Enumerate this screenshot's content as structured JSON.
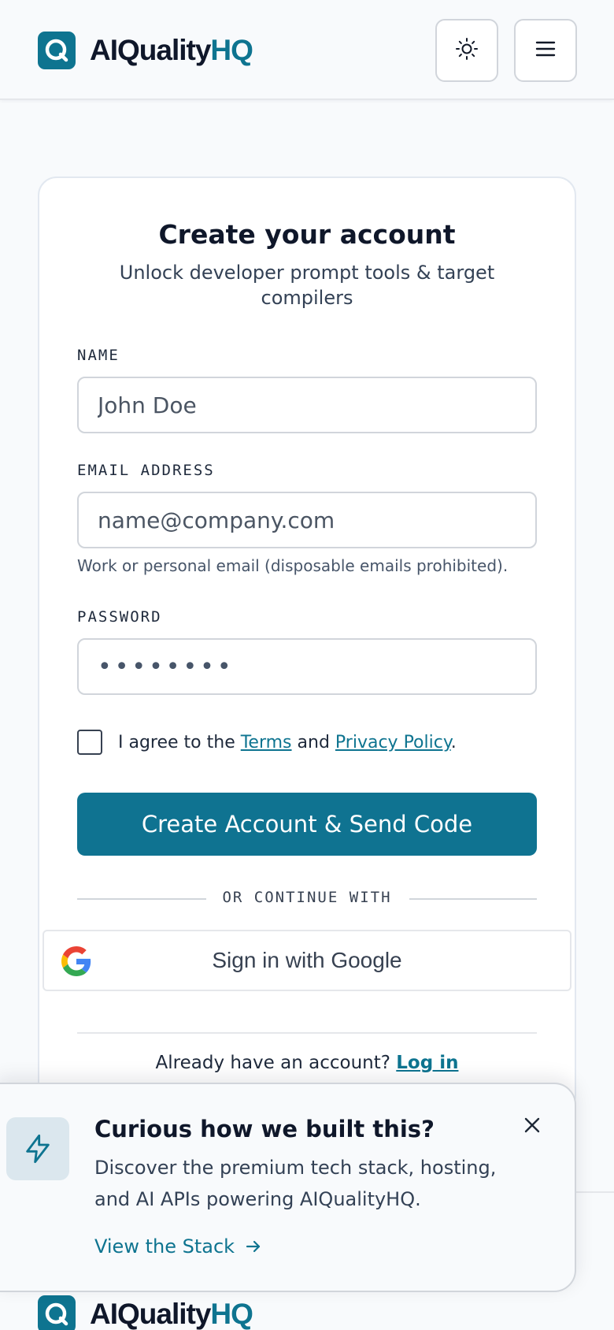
{
  "header": {
    "logo_main": "AIQuality",
    "logo_accent": "HQ"
  },
  "signup": {
    "title": "Create your account",
    "subtitle": "Unlock developer prompt tools & target compilers",
    "name_label": "NAME",
    "name_placeholder": "John Doe",
    "email_label": "EMAIL ADDRESS",
    "email_placeholder": "name@company.com",
    "email_hint": "Work or personal email (disposable emails prohibited).",
    "password_label": "PASSWORD",
    "password_value": "••••••••",
    "agree_prefix": "I agree to the ",
    "terms_link": "Terms",
    "agree_and": " and ",
    "privacy_link": "Privacy Policy",
    "agree_suffix": ".",
    "submit_label": "Create Account & Send Code",
    "or_text": "OR CONTINUE WITH",
    "google_label": "Sign in with Google",
    "login_prompt": "Already have an account? ",
    "login_link": "Log in"
  },
  "toast": {
    "title": "Curious how we built this?",
    "body": "Discover the premium tech stack, hosting, and AI APIs powering AIQualityHQ.",
    "link_label": "View the Stack"
  },
  "footer": {
    "logo_main": "AIQuality",
    "logo_accent": "HQ"
  },
  "colors": {
    "brand": "#0e7490",
    "button": "#0f7391",
    "text": "#0f172a"
  },
  "icons": [
    "logo-q-icon",
    "sun-icon",
    "menu-icon",
    "google-icon",
    "lightning-icon",
    "close-icon",
    "arrow-right-icon"
  ]
}
